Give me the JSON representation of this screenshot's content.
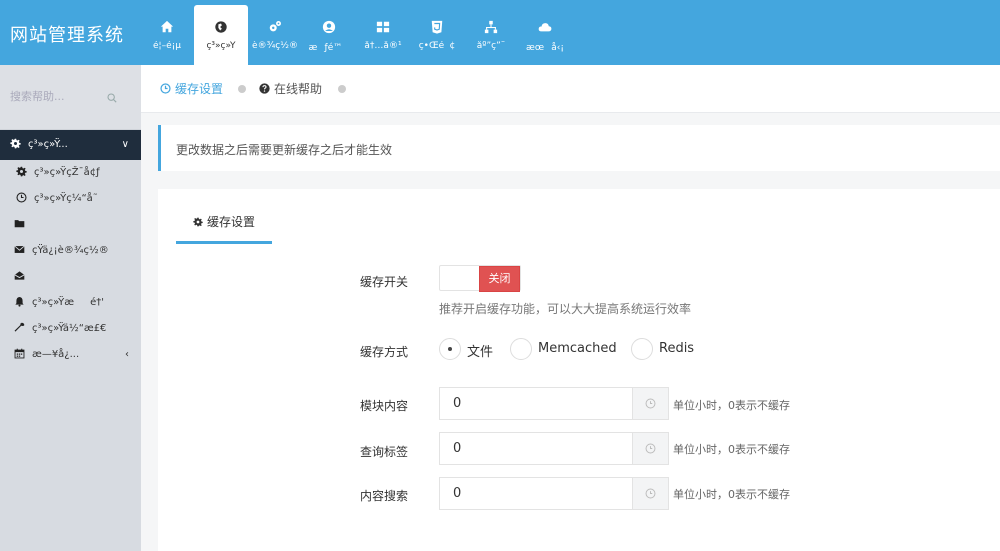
{
  "app": {
    "title": "网站管理系统"
  },
  "topnav": [
    {
      "label": "é¦–é¡µ",
      "icon": "home-icon"
    },
    {
      "label": "ç³»ç»Ÿ",
      "icon": "globe-icon",
      "active": true
    },
    {
      "label": "è®¾ç½®",
      "icon": "cogs-icon"
    },
    {
      "label": "æƒé™",
      "icon": "user-circle-icon"
    },
    {
      "label": "å†…å®¹",
      "icon": "grid-icon"
    },
    {
      "label": "ç•Œé¢",
      "icon": "html5-icon"
    },
    {
      "label": "åº”ç”¨",
      "icon": "sitemap-icon"
    },
    {
      "label": "æœå‹¡",
      "icon": "cloud-icon"
    }
  ],
  "sidebar": {
    "search_placeholder": "搜索帮助...",
    "items": [
      {
        "label": "ç³»ç»Ÿ...",
        "icon": "gear-icon",
        "top": true
      },
      {
        "label": "ç³»ç»ŸçŽ¯å¢ƒ",
        "icon": "gear-icon",
        "sub": true
      },
      {
        "label": "ç³»ç»Ÿç¼“å­˜",
        "icon": "clock-icon",
        "sub": true
      },
      {
        "label": "",
        "icon": "folder-icon"
      },
      {
        "label": "çŸ­ä¿¡è®¾ç½®",
        "icon": "envelope-icon"
      },
      {
        "label": "",
        "icon": "envelope-open-icon"
      },
      {
        "label": "ç³»ç»Ÿæé†'",
        "icon": "bell-icon"
      },
      {
        "label": "ç³»ç»Ÿä½“æ£€",
        "icon": "wrench-icon"
      },
      {
        "label": "æ—¥å¿...",
        "icon": "calendar-icon",
        "chevron": "‹"
      }
    ]
  },
  "breadcrumb": [
    {
      "label": "缓存设置",
      "icon": "clock-icon",
      "color": "#44a6de"
    },
    {
      "label": "在线帮助",
      "icon": "question-circle-icon",
      "color": "#555555"
    }
  ],
  "notice": "更改数据之后需要更新缓存之后才能生效",
  "panel": {
    "tab_label": "缓存设置",
    "cache_switch": {
      "label": "缓存开关",
      "off_label": "关闭",
      "hint": "推荐开启缓存功能，可以大大提高系统运行效率"
    },
    "cache_mode": {
      "label": "缓存方式",
      "options": [
        {
          "label": "文件",
          "checked": true
        },
        {
          "label": "Memcached",
          "checked": false
        },
        {
          "label": "Redis",
          "checked": false
        }
      ]
    },
    "fields": [
      {
        "label": "模块内容",
        "value": "0",
        "hint": "单位小时，0表示不缓存"
      },
      {
        "label": "查询标签",
        "value": "0",
        "hint": "单位小时，0表示不缓存"
      },
      {
        "label": "内容搜索",
        "value": "0",
        "hint": "单位小时，0表示不缓存"
      }
    ]
  }
}
